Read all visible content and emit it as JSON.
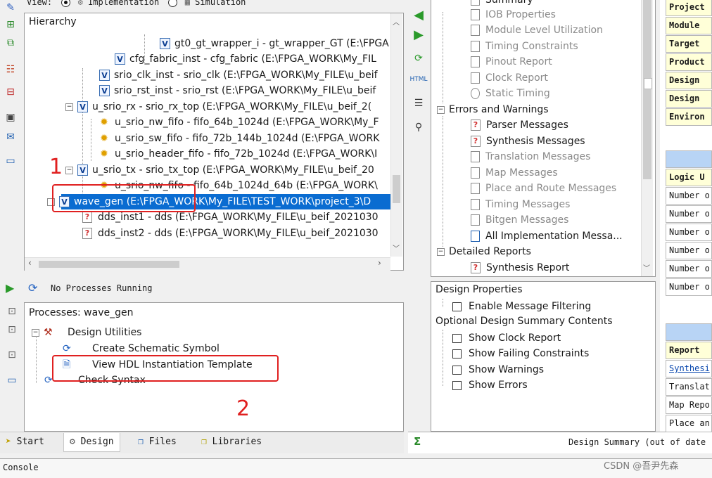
{
  "view_bar": {
    "label": "View:",
    "implementation": "Implementation",
    "simulation": "Simulation"
  },
  "hierarchy": {
    "title": "Hierarchy",
    "rows": [
      {
        "text": "gt0_gt_wrapper_i - gt_wrapper_GT (E:\\FPGA",
        "icon": "v"
      },
      {
        "text": "cfg_fabric_inst - cfg_fabric (E:\\FPGA_WORK\\My_FIL",
        "icon": "v"
      },
      {
        "text": "srio_clk_inst - srio_clk (E:\\FPGA_WORK\\My_FILE\\u_beif",
        "icon": "v"
      },
      {
        "text": "srio_rst_inst - srio_rst (E:\\FPGA_WORK\\My_FILE\\u_beif",
        "icon": "v"
      },
      {
        "text": "u_srio_rx - srio_rx_top (E:\\FPGA_WORK\\My_FILE\\u_beif_2(",
        "icon": "v"
      },
      {
        "text": "u_srio_nw_fifo - fifo_64b_1024d (E:\\FPGA_WORK\\My_F",
        "icon": "bulb"
      },
      {
        "text": "u_srio_sw_fifo - fifo_72b_144b_1024d (E:\\FPGA_WORK",
        "icon": "bulb"
      },
      {
        "text": "u_srio_header_fifo - fifo_72b_1024d (E:\\FPGA_WORK\\I",
        "icon": "bulb"
      },
      {
        "text": "u_srio_tx - srio_tx_top (E:\\FPGA_WORK\\My_FILE\\u_beif_20",
        "icon": "v"
      },
      {
        "text": "u_srio_nw_fifo - fifo_64b_1024d_64b (E:\\FPGA_WORK\\",
        "icon": "bulb"
      },
      {
        "text": "wave_gen (E:\\FPGA_WORK\\My_FILE\\TEST_WORK\\project_3\\D",
        "icon": "v"
      },
      {
        "text": "dds_inst1 - dds (E:\\FPGA_WORK\\My_FILE\\u_beif_2021030",
        "icon": "q"
      },
      {
        "text": "dds_inst2 - dds (E:\\FPGA_WORK\\My_FILE\\u_beif_2021030",
        "icon": "q"
      }
    ]
  },
  "processes": {
    "status": "No Processes Running",
    "title": "Processes: wave_gen",
    "items": [
      {
        "text": "Design Utilities"
      },
      {
        "text": "Create Schematic Symbol"
      },
      {
        "text": "View HDL Instantiation Template"
      },
      {
        "text": "Check Syntax"
      }
    ]
  },
  "annotations": {
    "one": "1",
    "two": "2"
  },
  "bottom_tabs": {
    "start": "Start",
    "design": "Design",
    "files": "Files",
    "libraries": "Libraries"
  },
  "console": "Console",
  "summary_tree": {
    "rows": [
      {
        "text": "Summary",
        "gray": false
      },
      {
        "text": "IOB Properties",
        "gray": true
      },
      {
        "text": "Module Level Utilization",
        "gray": true
      },
      {
        "text": "Timing Constraints",
        "gray": true
      },
      {
        "text": "Pinout Report",
        "gray": true
      },
      {
        "text": "Clock Report",
        "gray": true
      },
      {
        "text": "Static Timing",
        "gray": true
      },
      {
        "text": "Errors and Warnings",
        "gray": false
      },
      {
        "text": "Parser Messages",
        "gray": false
      },
      {
        "text": "Synthesis Messages",
        "gray": false
      },
      {
        "text": "Translation Messages",
        "gray": true
      },
      {
        "text": "Map Messages",
        "gray": true
      },
      {
        "text": "Place and Route Messages",
        "gray": true
      },
      {
        "text": "Timing Messages",
        "gray": true
      },
      {
        "text": "Bitgen Messages",
        "gray": true
      },
      {
        "text": "All Implementation Messa...",
        "gray": false
      },
      {
        "text": "Detailed Reports",
        "gray": false
      },
      {
        "text": "Synthesis Report",
        "gray": false
      }
    ]
  },
  "design_properties": {
    "title": "Design Properties",
    "enable_filtering": "Enable Message Filtering",
    "optional_title": "Optional Design Summary Contents",
    "options": [
      "Show Clock Report",
      "Show Failing Constraints",
      "Show Warnings",
      "Show Errors"
    ]
  },
  "summary_table": {
    "top_labels": [
      "Project",
      "Module",
      "Target",
      "Product",
      "Design",
      "Design",
      "Environ"
    ],
    "logic_header": "Logic U",
    "logic_rows": [
      "Number o",
      "Number o",
      "Number o",
      "Number o",
      "Number o",
      "Number o"
    ],
    "report_header": "Report",
    "report_rows": [
      "Synthesi",
      "Translat",
      "Map Repo",
      "Place an"
    ]
  },
  "design_summary_tab": "Design Summary (out of date",
  "watermark": "CSDN @吾尹先森"
}
